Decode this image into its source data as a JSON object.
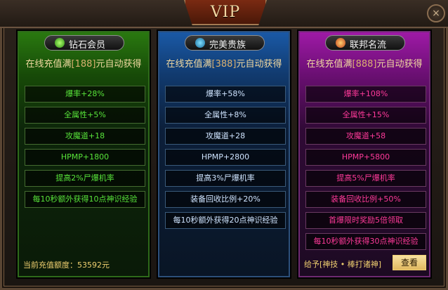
{
  "title": "VIP",
  "close_label": "×",
  "panels": [
    {
      "name": "钻石会员",
      "prefix": "在线充值满",
      "amount": "[188]",
      "suffix": "元自动获得",
      "benefits": [
        "爆率+28%",
        "全属性+5%",
        "攻魔道+18",
        "HPMP+1800",
        "提高2%尸爆机率",
        "每10秒额外获得10点神识经验"
      ],
      "footer": "当前充值额度：53592元"
    },
    {
      "name": "完美贵族",
      "prefix": "在线充值满",
      "amount": "[388]",
      "suffix": "元自动获得",
      "benefits": [
        "爆率+58%",
        "全属性+8%",
        "攻魔道+28",
        "HPMP+2800",
        "提高3%尸爆机率",
        "装备回收比例+20%",
        "每10秒额外获得20点神识经验"
      ]
    },
    {
      "name": "联邦名流",
      "prefix": "在线充值满",
      "amount": "[888]",
      "suffix": "元自动获得",
      "benefits": [
        "爆率+108%",
        "全属性+15%",
        "攻魔道+58",
        "HPMP+5800",
        "提高5%尸爆机率",
        "装备回收比例+50%",
        "首爆限时奖励5倍领取",
        "每10秒额外获得30点神识经验"
      ],
      "grant": "给予[神技 • 棒打诸神]",
      "view_button": "查看"
    }
  ],
  "colors": {
    "green_text": "#58e43a",
    "blue_text": "#cfe4ff",
    "pink_text": "#ff3a9a",
    "gold_text": "#f0d070"
  },
  "icons": [
    "diamond-icon",
    "gem-icon",
    "crown-icon"
  ]
}
